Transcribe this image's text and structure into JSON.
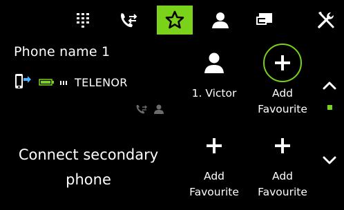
{
  "colors": {
    "accent": "#7ad21a",
    "icon_active": "#000000",
    "icon_inactive": "#ffffff",
    "muted": "#6b6b6b",
    "battery": "#7ad21a"
  },
  "tabbar": {
    "tabs": [
      {
        "icon": "dialpad-icon",
        "active": false
      },
      {
        "icon": "call-log-icon",
        "active": false
      },
      {
        "icon": "star-icon",
        "active": true
      },
      {
        "icon": "contact-icon",
        "active": false
      },
      {
        "icon": "messages-icon",
        "active": false
      },
      {
        "icon": "settings-icon",
        "active": false
      }
    ]
  },
  "phone": {
    "name": "Phone name 1",
    "operator": "TELENOR",
    "connect_secondary": "Connect secondary phone",
    "connect_secondary_line1": "Connect secondary",
    "connect_secondary_line2": "phone"
  },
  "favourites": [
    {
      "label": "1. Victor",
      "icon": "person-icon"
    },
    {
      "label_line1": "Add",
      "label_line2": "Favourite",
      "icon": "add-icon",
      "highlighted": true
    },
    {
      "label_line1": "Add",
      "label_line2": "Favourite",
      "icon": "add-icon"
    },
    {
      "label_line1": "Add",
      "label_line2": "Favourite",
      "icon": "add-icon"
    }
  ],
  "scroll": {
    "up_icon": "chevron-up-icon",
    "down_icon": "chevron-down-icon"
  }
}
